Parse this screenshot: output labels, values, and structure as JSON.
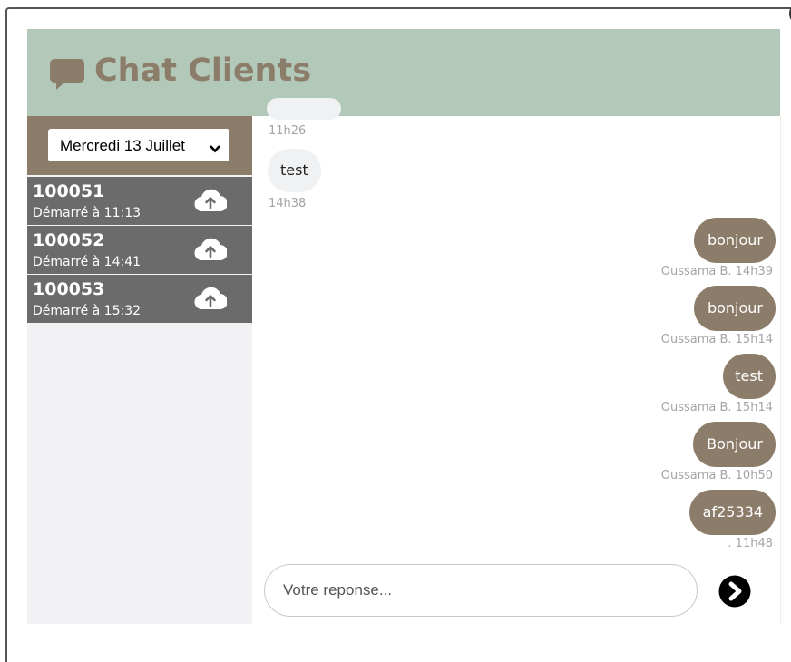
{
  "header": {
    "title": "Chat Clients",
    "icon": "speech-bubble-icon",
    "background": "#b2c8b9",
    "title_color": "#8c7d6a"
  },
  "sidebar": {
    "date_select": {
      "value": "Mercredi 13 Juillet"
    },
    "conversations": [
      {
        "id": "100051",
        "started": "Démarré à 11:13",
        "icon": "cloud-upload-icon"
      },
      {
        "id": "100052",
        "started": "Démarré à 14:41",
        "icon": "cloud-upload-icon"
      },
      {
        "id": "100053",
        "started": "Démarré à 15:32",
        "icon": "cloud-upload-icon"
      }
    ]
  },
  "messages": [
    {
      "direction": "in",
      "text": "",
      "meta": "11h26"
    },
    {
      "direction": "in",
      "text": "test",
      "meta": "14h38"
    },
    {
      "direction": "out",
      "text": "bonjour",
      "meta": "Oussama B. 14h39"
    },
    {
      "direction": "out",
      "text": "bonjour",
      "meta": "Oussama B. 15h14"
    },
    {
      "direction": "out",
      "text": "test",
      "meta": "Oussama B. 15h14"
    },
    {
      "direction": "out",
      "text": "Bonjour",
      "meta": "Oussama B. 10h50"
    },
    {
      "direction": "out",
      "text": "af25334",
      "meta": ". 11h48"
    }
  ],
  "composer": {
    "placeholder": "Votre reponse...",
    "send_icon": "arrow-right-circle-icon"
  },
  "colors": {
    "accent": "#8c7d6a",
    "list_item": "#6b6b6b",
    "incoming_bubble": "#f0f1f3"
  }
}
